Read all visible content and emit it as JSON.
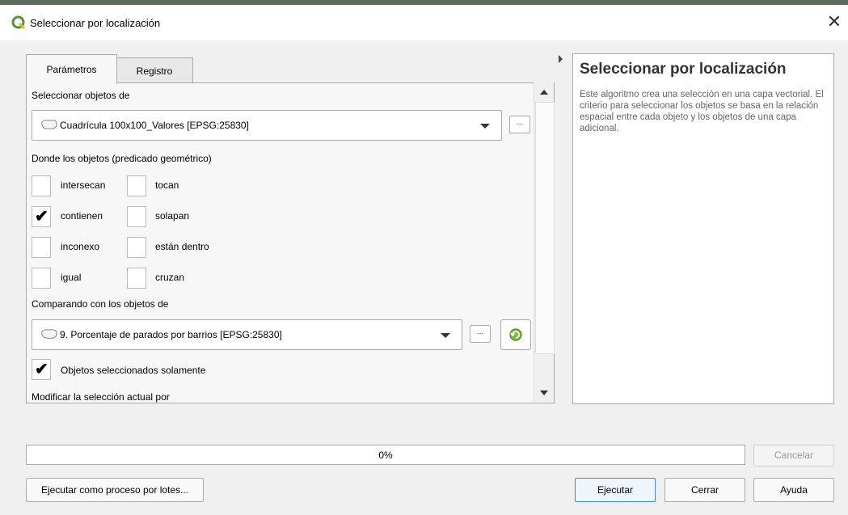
{
  "window": {
    "title": "Seleccionar por localización"
  },
  "tabs": [
    {
      "label": "Parámetros"
    },
    {
      "label": "Registro"
    }
  ],
  "params": {
    "select_from_label": "Seleccionar objetos de",
    "select_from_value": "Cuadrícula 100x100_Valores [EPSG:25830]",
    "predicate_label": "Donde los objetos (predicado geométrico)",
    "predicates": [
      {
        "label": "intersecan",
        "checked": false
      },
      {
        "label": "tocan",
        "checked": false
      },
      {
        "label": "contienen",
        "checked": true
      },
      {
        "label": "solapan",
        "checked": false
      },
      {
        "label": "inconexo",
        "checked": false
      },
      {
        "label": "están dentro",
        "checked": false
      },
      {
        "label": "igual",
        "checked": false
      },
      {
        "label": "cruzan",
        "checked": false
      }
    ],
    "compare_label": "Comparando con los objetos de",
    "compare_value": "9. Porcentaje de parados por barrios [EPSG:25830]",
    "selected_only_label": "Objetos seleccionados solamente",
    "modify_label": "Modificar la selección actual por",
    "dots": "..."
  },
  "help": {
    "title": "Seleccionar por localización",
    "body": "Este algoritmo crea una selección en una capa vectorial. El criterio para seleccionar los objetos se basa en la relación espacial entre cada objeto y los objetos de una capa adicional."
  },
  "progress": {
    "text": "0%",
    "value": 0
  },
  "buttons": {
    "cancel": "Cancelar",
    "batch": "Ejecutar como proceso por lotes...",
    "run": "Ejecutar",
    "close": "Cerrar",
    "help": "Ayuda"
  },
  "colors": {
    "qgis_green": "#589632",
    "accent": "#3c8bd8"
  }
}
